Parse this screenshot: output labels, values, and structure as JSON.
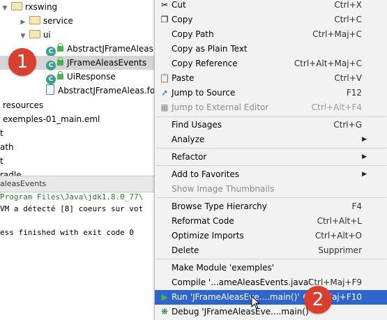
{
  "tree": {
    "rows": [
      {
        "label": "rxswing"
      },
      {
        "label": "service"
      },
      {
        "label": "ui"
      },
      {
        "label": "AbstractJFrameAleas"
      },
      {
        "label": "JFrameAleasEvents"
      },
      {
        "label": "UiResponse"
      },
      {
        "label": "AbstractJFrameAleas.form"
      },
      {
        "label": "resources"
      },
      {
        "label": "exemples-01_main.eml"
      },
      {
        "label": "t"
      },
      {
        "label": "ath"
      },
      {
        "label": "t"
      },
      {
        "label": "radle"
      }
    ]
  },
  "badges": {
    "one": "1",
    "two": "2"
  },
  "run": {
    "tab_label": "aleasEvents",
    "lines": [
      "Program Files\\Java\\jdk1.8.0_77\\",
      "VM a détecté [8] coeurs sur vot",
      "",
      "ess finished with exit code 0"
    ]
  },
  "menu": {
    "items": [
      {
        "label": "Cut",
        "shortcut": "Ctrl+X",
        "icon": "scissors-icon"
      },
      {
        "label": "Copy",
        "shortcut": "Ctrl+C",
        "icon": "copy-icon"
      },
      {
        "label": "Copy Path",
        "shortcut": "Ctrl+Maj+C"
      },
      {
        "label": "Copy as Plain Text",
        "shortcut": ""
      },
      {
        "label": "Copy Reference",
        "shortcut": "Ctrl+Alt+Maj+C"
      },
      {
        "label": "Paste",
        "shortcut": "Ctrl+V",
        "icon": "paste-icon"
      },
      {
        "label": "Jump to Source",
        "shortcut": "F12",
        "icon": "jump-icon"
      },
      {
        "label": "Jump to External Editor",
        "shortcut": "Ctrl+Alt+F4",
        "icon": "external-editor-icon",
        "disabled": true
      },
      {
        "label": "Find Usages",
        "shortcut": "Ctrl+G"
      },
      {
        "label": "Analyze",
        "shortcut": "",
        "submenu": true
      },
      {
        "label": "Refactor",
        "shortcut": "",
        "submenu": true
      },
      {
        "label": "Add to Favorites",
        "shortcut": "",
        "submenu": true
      },
      {
        "label": "Show Image Thumbnails",
        "shortcut": "",
        "disabled": true
      },
      {
        "label": "Browse Type Hierarchy",
        "shortcut": "F4"
      },
      {
        "label": "Reformat Code",
        "shortcut": "Ctrl+Alt+L"
      },
      {
        "label": "Optimize Imports",
        "shortcut": "Ctrl+Alt+O"
      },
      {
        "label": "Delete",
        "shortcut": "Supprimer"
      },
      {
        "label": "Make Module 'exemples'",
        "shortcut": ""
      },
      {
        "label": "Compile '...ameAleasEvents.java'",
        "shortcut": "Ctrl+Maj+F9"
      },
      {
        "label": "Run 'JFrameAleasEve....main()'",
        "shortcut": "Ctrl+Maj+F10",
        "icon": "run-icon",
        "highlighted": true
      },
      {
        "label": "Debug 'JFrameAleasEve....main()'",
        "shortcut": "",
        "icon": "debug-icon"
      }
    ]
  },
  "colors": {
    "highlight": "#2f65ca",
    "badge": "#d93f2e",
    "menu_bg": "#f2f2f2"
  }
}
